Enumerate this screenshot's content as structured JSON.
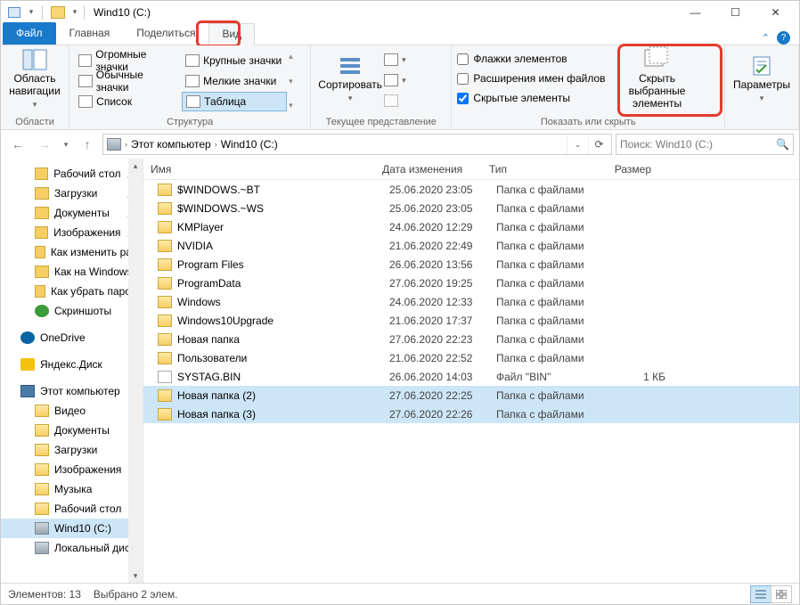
{
  "window": {
    "title": "Wind10 (C:)"
  },
  "tabs": {
    "file": "Файл",
    "home": "Главная",
    "share": "Поделиться",
    "view": "Вид"
  },
  "ribbon": {
    "navpane": {
      "btn1": "Область навигации",
      "label": "Области"
    },
    "layout": {
      "items": [
        "Огромные значки",
        "Крупные значки",
        "Обычные значки",
        "Мелкие значки",
        "Список",
        "Таблица"
      ],
      "label": "Структура"
    },
    "sort": {
      "btn": "Сортировать",
      "label": "Текущее представление"
    },
    "show": {
      "chk1": "Флажки элементов",
      "chk2": "Расширения имен файлов",
      "chk3": "Скрытые элементы",
      "hide_btn": "Скрыть выбранные элементы",
      "label": "Показать или скрыть"
    },
    "options": {
      "btn": "Параметры"
    }
  },
  "address": {
    "seg1": "Этот компьютер",
    "seg2": "Wind10 (C:)",
    "search_placeholder": "Поиск: Wind10 (C:)"
  },
  "nav": {
    "items": [
      {
        "label": "Рабочий стол",
        "pinned": true,
        "icon": "desktop"
      },
      {
        "label": "Загрузки",
        "pinned": true,
        "icon": "downloads"
      },
      {
        "label": "Документы",
        "pinned": true,
        "icon": "documents"
      },
      {
        "label": "Изображения",
        "pinned": true,
        "icon": "pictures"
      },
      {
        "label": "Как изменить разр",
        "pinned": false,
        "icon": "folder"
      },
      {
        "label": "Как на Windows",
        "pinned": false,
        "icon": "folder"
      },
      {
        "label": "Как убрать пароль",
        "pinned": false,
        "icon": "folder"
      },
      {
        "label": "Скриншоты",
        "pinned": false,
        "icon": "check"
      }
    ],
    "onedrive": "OneDrive",
    "yadisk": "Яндекс.Диск",
    "thispc": "Этот компьютер",
    "pcitems": [
      {
        "label": "Видео"
      },
      {
        "label": "Документы"
      },
      {
        "label": "Загрузки"
      },
      {
        "label": "Изображения"
      },
      {
        "label": "Музыка"
      },
      {
        "label": "Рабочий стол"
      },
      {
        "label": "Wind10 (C:)",
        "selected": true,
        "drive": true
      },
      {
        "label": "Локальный диск",
        "drive": true
      }
    ]
  },
  "columns": {
    "name": "Имя",
    "date": "Дата изменения",
    "type": "Тип",
    "size": "Размер"
  },
  "files": [
    {
      "name": "$WINDOWS.~BT",
      "date": "25.06.2020 23:05",
      "type": "Папка с файлами",
      "size": "",
      "folder": true
    },
    {
      "name": "$WINDOWS.~WS",
      "date": "25.06.2020 23:05",
      "type": "Папка с файлами",
      "size": "",
      "folder": true
    },
    {
      "name": "KMPlayer",
      "date": "24.06.2020 12:29",
      "type": "Папка с файлами",
      "size": "",
      "folder": true
    },
    {
      "name": "NVIDIA",
      "date": "21.06.2020 22:49",
      "type": "Папка с файлами",
      "size": "",
      "folder": true
    },
    {
      "name": "Program Files",
      "date": "26.06.2020 13:56",
      "type": "Папка с файлами",
      "size": "",
      "folder": true
    },
    {
      "name": "ProgramData",
      "date": "27.06.2020 19:25",
      "type": "Папка с файлами",
      "size": "",
      "folder": true
    },
    {
      "name": "Windows",
      "date": "24.06.2020 12:33",
      "type": "Папка с файлами",
      "size": "",
      "folder": true
    },
    {
      "name": "Windows10Upgrade",
      "date": "21.06.2020 17:37",
      "type": "Папка с файлами",
      "size": "",
      "folder": true
    },
    {
      "name": "Новая папка",
      "date": "27.06.2020 22:23",
      "type": "Папка с файлами",
      "size": "",
      "folder": true
    },
    {
      "name": "Пользователи",
      "date": "21.06.2020 22:52",
      "type": "Папка с файлами",
      "size": "",
      "folder": true
    },
    {
      "name": "SYSTAG.BIN",
      "date": "26.06.2020 14:03",
      "type": "Файл \"BIN\"",
      "size": "1 КБ",
      "folder": false
    },
    {
      "name": "Новая папка (2)",
      "date": "27.06.2020 22:25",
      "type": "Папка с файлами",
      "size": "",
      "folder": true,
      "selected": true
    },
    {
      "name": "Новая папка (3)",
      "date": "27.06.2020 22:26",
      "type": "Папка с файлами",
      "size": "",
      "folder": true,
      "selected": true
    }
  ],
  "status": {
    "count": "Элементов: 13",
    "sel": "Выбрано 2 элем."
  }
}
